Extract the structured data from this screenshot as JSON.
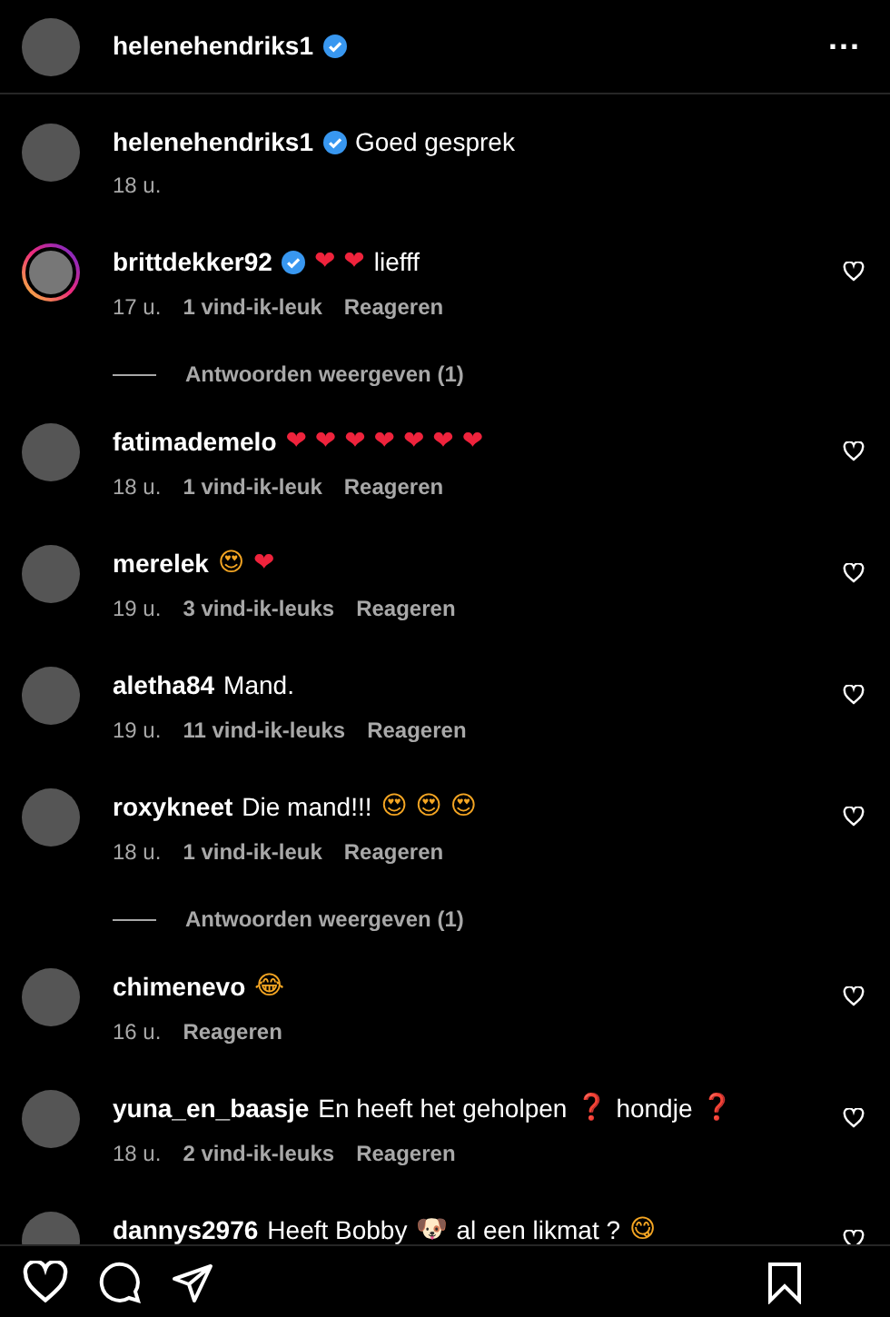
{
  "header": {
    "username": "helenehendriks1",
    "verified": true,
    "more_label": "..."
  },
  "caption": {
    "username": "helenehendriks1",
    "verified": true,
    "text": "Goed gesprek",
    "time": "18 u."
  },
  "comments": [
    {
      "username": "brittdekker92",
      "verified": true,
      "story_ring": true,
      "parts": [
        {
          "kind": "emoji",
          "text": "❤ ❤",
          "color": "#ef233c"
        },
        {
          "kind": "text",
          "text": "liefff"
        }
      ],
      "time": "17 u.",
      "likes": "1 vind-ik-leuk",
      "reply": "Reageren",
      "replies_link": "Antwoorden weergeven (1)"
    },
    {
      "username": "fatimademelo",
      "parts": [
        {
          "kind": "emoji",
          "text": "❤ ❤ ❤ ❤ ❤ ❤ ❤",
          "color": "#ef233c"
        }
      ],
      "time": "18 u.",
      "likes": "1 vind-ik-leuk",
      "reply": "Reageren"
    },
    {
      "username": "merelek",
      "parts": [
        {
          "kind": "emoji",
          "text": "😍",
          "color": "#f5a623"
        },
        {
          "kind": "emoji",
          "text": "❤",
          "color": "#ef233c"
        }
      ],
      "time": "19 u.",
      "likes": "3 vind-ik-leuks",
      "reply": "Reageren"
    },
    {
      "username": "aletha84",
      "parts": [
        {
          "kind": "text",
          "text": "Mand."
        }
      ],
      "time": "19 u.",
      "likes": "11 vind-ik-leuks",
      "reply": "Reageren"
    },
    {
      "username": "roxykneet",
      "parts": [
        {
          "kind": "text",
          "text": "Die mand!!!"
        },
        {
          "kind": "emoji",
          "text": "😍 😍 😍",
          "color": "#f5a623"
        }
      ],
      "time": "18 u.",
      "likes": "1 vind-ik-leuk",
      "reply": "Reageren",
      "replies_link": "Antwoorden weergeven (1)"
    },
    {
      "username": "chimenevo",
      "parts": [
        {
          "kind": "emoji",
          "text": "😂",
          "color": "#f5a623"
        }
      ],
      "time": "16 u.",
      "reply": "Reageren"
    },
    {
      "username": "yuna_en_baasje",
      "parts": [
        {
          "kind": "text",
          "text": "En heeft het geholpen"
        },
        {
          "kind": "emoji",
          "text": "❓"
        },
        {
          "kind": "text",
          "text": "hondje"
        },
        {
          "kind": "emoji",
          "text": "❓"
        }
      ],
      "time": "18 u.",
      "likes": "2 vind-ik-leuks",
      "reply": "Reageren"
    },
    {
      "username": "dannys2976",
      "parts": [
        {
          "kind": "text",
          "text": "Heeft Bobby"
        },
        {
          "kind": "emoji",
          "text": "🐶"
        },
        {
          "kind": "text",
          "text": "al een likmat ?"
        },
        {
          "kind": "emoji",
          "text": "😋",
          "color": "#f5a623"
        }
      ]
    }
  ]
}
